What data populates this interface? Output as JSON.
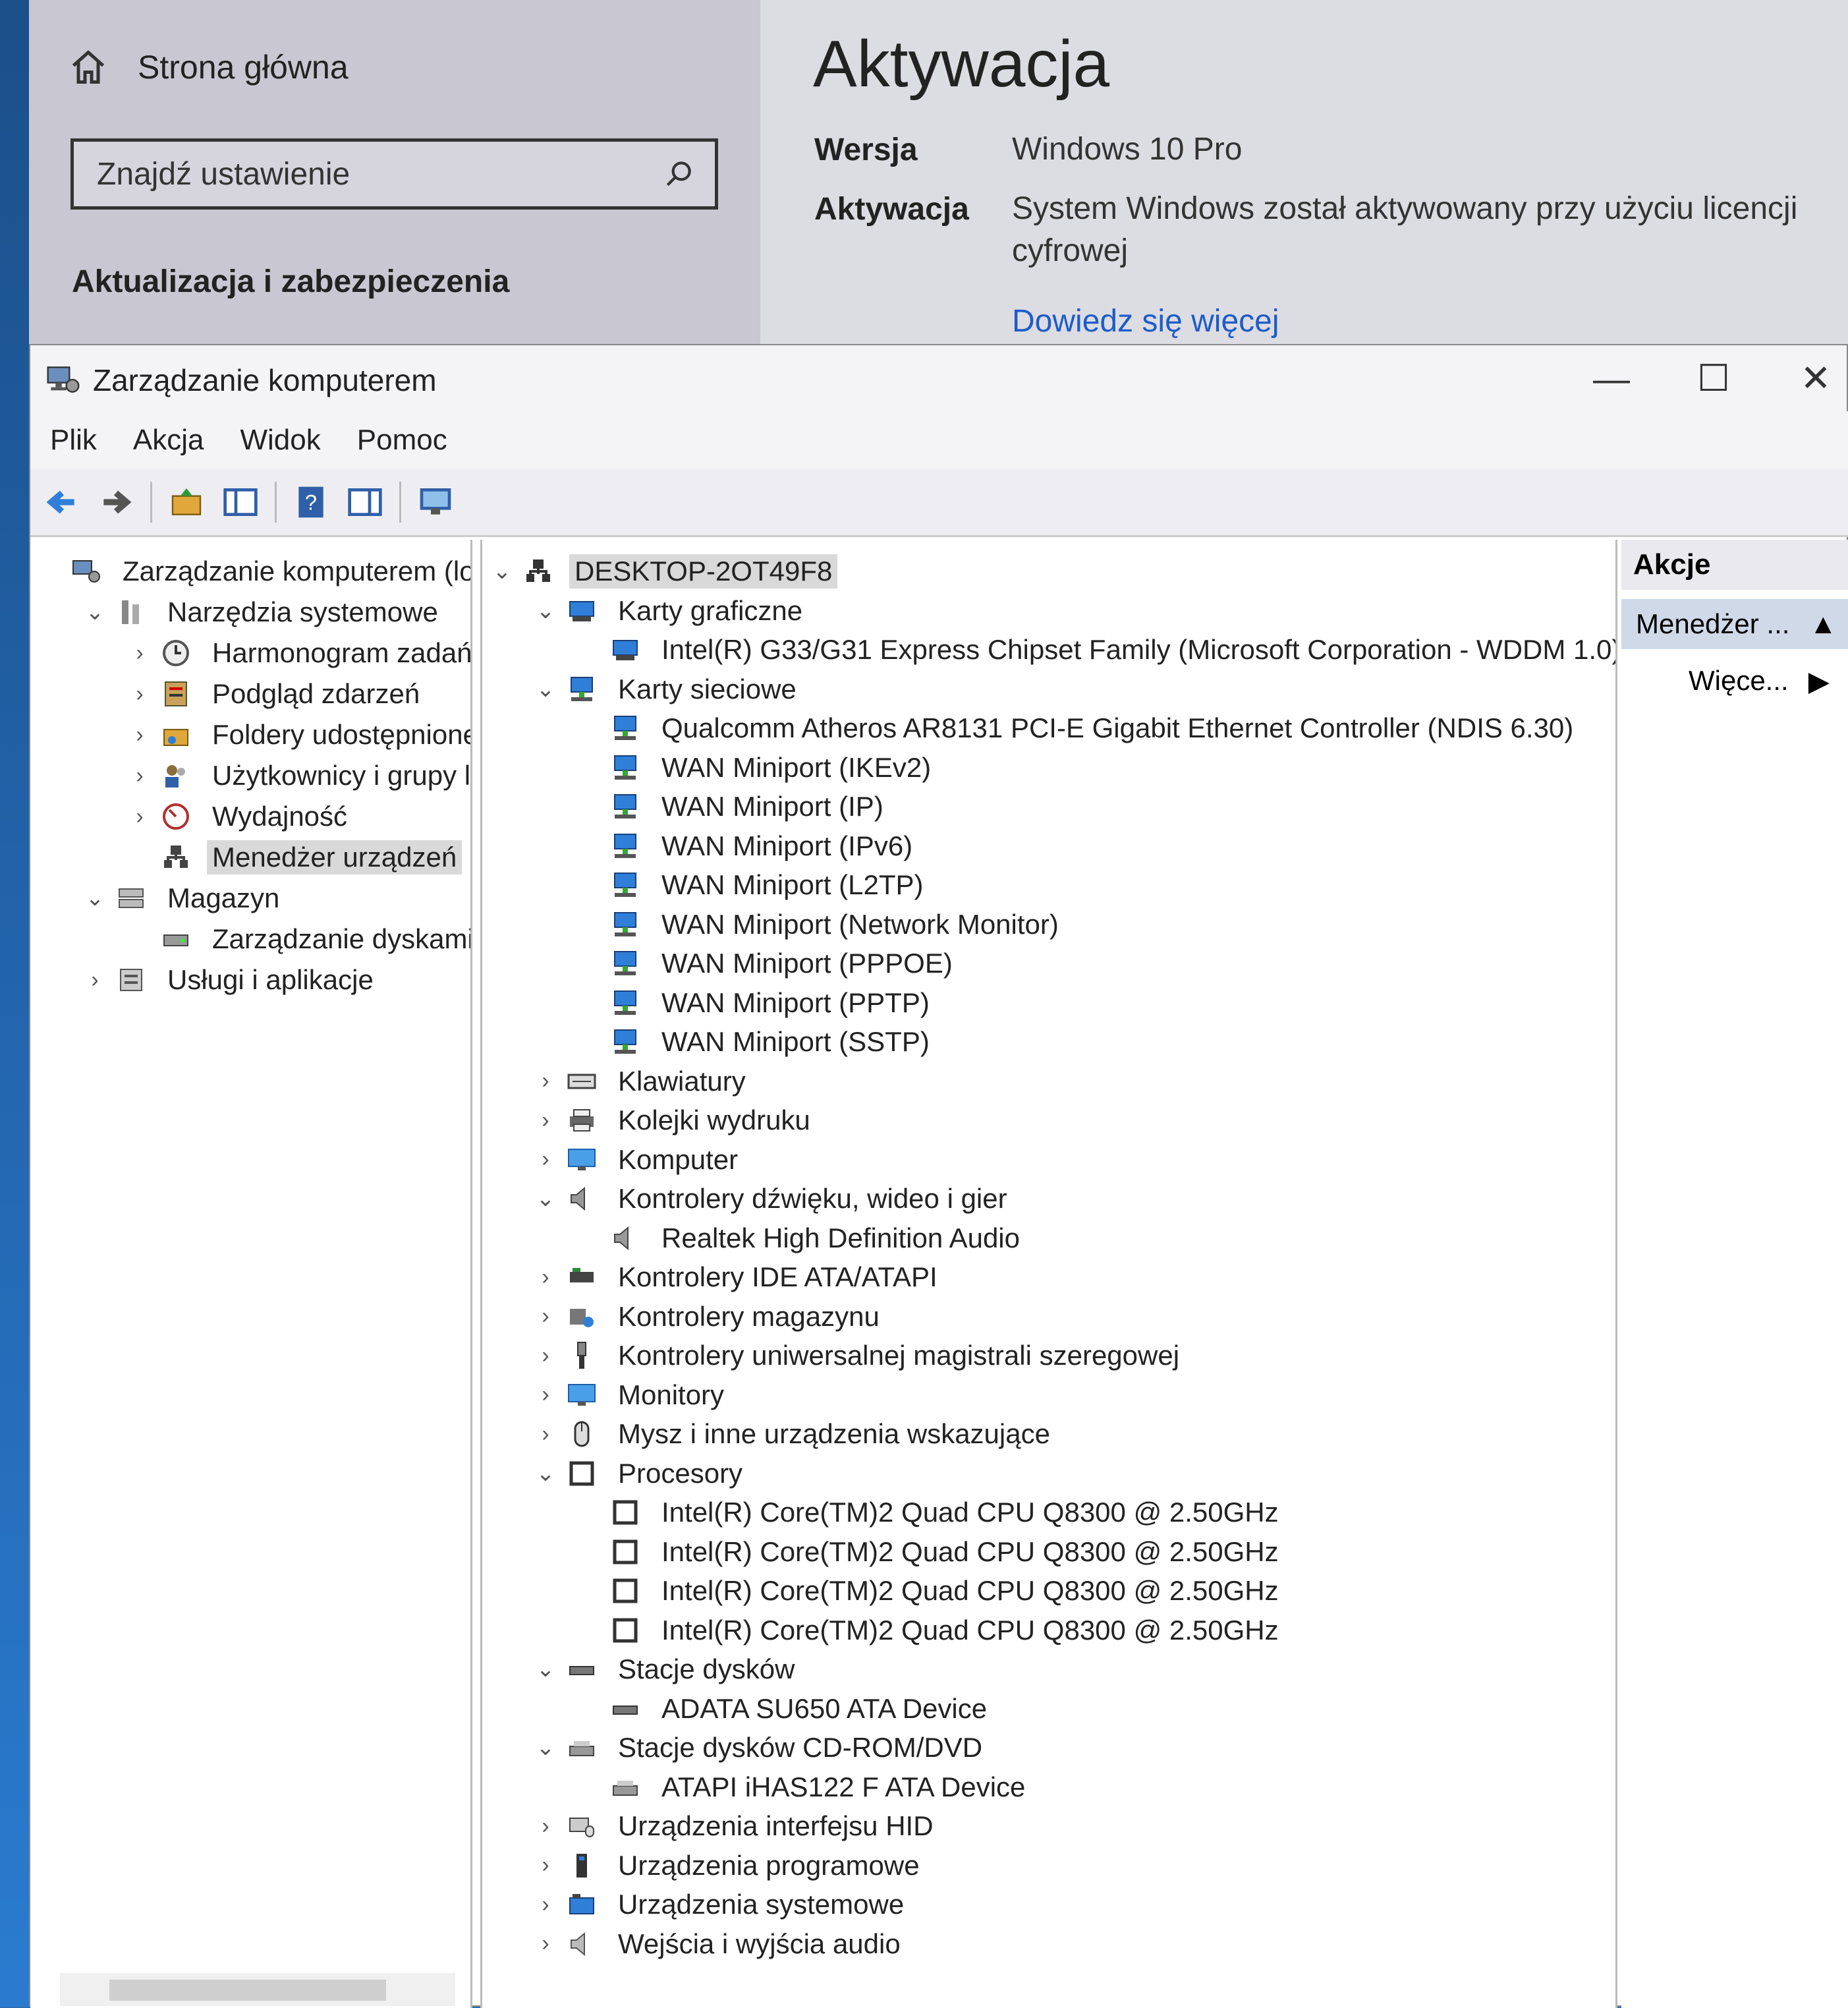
{
  "settings": {
    "home_label": "Strona główna",
    "search_placeholder": "Znajdź ustawienie",
    "section_title": "Aktualizacja i zabezpieczenia",
    "page_title": "Aktywacja",
    "edition_label": "Wersja",
    "edition_value": "Windows 10 Pro",
    "activation_label": "Aktywacja",
    "activation_value": "System Windows został aktywowany przy użyciu licencji cyfrowej",
    "learn_more_link": "Dowiedz się więcej"
  },
  "window": {
    "title": "Zarządzanie komputerem",
    "minimize": "—",
    "maximize": "☐",
    "close": "✕"
  },
  "menu": [
    "Plik",
    "Akcja",
    "Widok",
    "Pomoc"
  ],
  "toolbar_icons": [
    "back-icon",
    "forward-icon",
    "up-folder-icon",
    "show-hide-tree-icon",
    "help-icon",
    "properties-icon",
    "monitor-icon"
  ],
  "left_tree": [
    {
      "label": "Zarządzanie komputerem (lokalny)",
      "level": 0,
      "chev": "",
      "icon": "computer-management-icon"
    },
    {
      "label": "Narzędzia systemowe",
      "level": 1,
      "chev": "down",
      "icon": "system-tools-icon"
    },
    {
      "label": "Harmonogram zadań",
      "level": 2,
      "chev": "right",
      "icon": "clock-icon"
    },
    {
      "label": "Podgląd zdarzeń",
      "level": 2,
      "chev": "right",
      "icon": "event-viewer-icon"
    },
    {
      "label": "Foldery udostępnione",
      "level": 2,
      "chev": "right",
      "icon": "shared-folder-icon"
    },
    {
      "label": "Użytkownicy i grupy lokalne",
      "level": 2,
      "chev": "right",
      "icon": "users-icon"
    },
    {
      "label": "Wydajność",
      "level": 2,
      "chev": "right",
      "icon": "performance-icon"
    },
    {
      "label": "Menedżer urządzeń",
      "level": 2,
      "chev": "",
      "icon": "device-manager-icon",
      "selected": true
    },
    {
      "label": "Magazyn",
      "level": 1,
      "chev": "down",
      "icon": "storage-icon"
    },
    {
      "label": "Zarządzanie dyskami",
      "level": 2,
      "chev": "",
      "icon": "disk-management-icon"
    },
    {
      "label": "Usługi i aplikacje",
      "level": 1,
      "chev": "right",
      "icon": "services-icon"
    }
  ],
  "device_tree": [
    {
      "label": "DESKTOP-2OT49F8",
      "level": 0,
      "chev": "down",
      "icon": "computer-node-icon",
      "selected": true
    },
    {
      "label": "Karty graficzne",
      "level": 1,
      "chev": "down",
      "icon": "display-adapter-icon"
    },
    {
      "label": "Intel(R) G33/G31 Express Chipset Family (Microsoft Corporation - WDDM 1.0)",
      "level": 2,
      "chev": "",
      "icon": "display-adapter-icon"
    },
    {
      "label": "Karty sieciowe",
      "level": 1,
      "chev": "down",
      "icon": "network-adapter-icon"
    },
    {
      "label": "Qualcomm Atheros AR8131 PCI-E Gigabit Ethernet Controller (NDIS 6.30)",
      "level": 2,
      "chev": "",
      "icon": "network-adapter-icon"
    },
    {
      "label": "WAN Miniport (IKEv2)",
      "level": 2,
      "chev": "",
      "icon": "network-adapter-icon"
    },
    {
      "label": "WAN Miniport (IP)",
      "level": 2,
      "chev": "",
      "icon": "network-adapter-icon"
    },
    {
      "label": "WAN Miniport (IPv6)",
      "level": 2,
      "chev": "",
      "icon": "network-adapter-icon"
    },
    {
      "label": "WAN Miniport (L2TP)",
      "level": 2,
      "chev": "",
      "icon": "network-adapter-icon"
    },
    {
      "label": "WAN Miniport (Network Monitor)",
      "level": 2,
      "chev": "",
      "icon": "network-adapter-icon"
    },
    {
      "label": "WAN Miniport (PPPOE)",
      "level": 2,
      "chev": "",
      "icon": "network-adapter-icon"
    },
    {
      "label": "WAN Miniport (PPTP)",
      "level": 2,
      "chev": "",
      "icon": "network-adapter-icon"
    },
    {
      "label": "WAN Miniport (SSTP)",
      "level": 2,
      "chev": "",
      "icon": "network-adapter-icon"
    },
    {
      "label": "Klawiatury",
      "level": 1,
      "chev": "right",
      "icon": "keyboard-icon"
    },
    {
      "label": "Kolejki wydruku",
      "level": 1,
      "chev": "right",
      "icon": "printer-icon"
    },
    {
      "label": "Komputer",
      "level": 1,
      "chev": "right",
      "icon": "monitor-icon"
    },
    {
      "label": "Kontrolery dźwięku, wideo i gier",
      "level": 1,
      "chev": "down",
      "icon": "speaker-icon"
    },
    {
      "label": "Realtek High Definition Audio",
      "level": 2,
      "chev": "",
      "icon": "speaker-icon"
    },
    {
      "label": "Kontrolery IDE ATA/ATAPI",
      "level": 1,
      "chev": "right",
      "icon": "ide-controller-icon"
    },
    {
      "label": "Kontrolery magazynu",
      "level": 1,
      "chev": "right",
      "icon": "storage-controller-icon"
    },
    {
      "label": "Kontrolery uniwersalnej magistrali szeregowej",
      "level": 1,
      "chev": "right",
      "icon": "usb-icon"
    },
    {
      "label": "Monitory",
      "level": 1,
      "chev": "right",
      "icon": "monitor-icon"
    },
    {
      "label": "Mysz i inne urządzenia wskazujące",
      "level": 1,
      "chev": "right",
      "icon": "mouse-icon"
    },
    {
      "label": "Procesory",
      "level": 1,
      "chev": "down",
      "icon": "processor-icon"
    },
    {
      "label": "Intel(R) Core(TM)2 Quad CPU    Q8300  @ 2.50GHz",
      "level": 2,
      "chev": "",
      "icon": "processor-icon"
    },
    {
      "label": "Intel(R) Core(TM)2 Quad CPU    Q8300  @ 2.50GHz",
      "level": 2,
      "chev": "",
      "icon": "processor-icon"
    },
    {
      "label": "Intel(R) Core(TM)2 Quad CPU    Q8300  @ 2.50GHz",
      "level": 2,
      "chev": "",
      "icon": "processor-icon"
    },
    {
      "label": "Intel(R) Core(TM)2 Quad CPU    Q8300  @ 2.50GHz",
      "level": 2,
      "chev": "",
      "icon": "processor-icon"
    },
    {
      "label": "Stacje dysków",
      "level": 1,
      "chev": "down",
      "icon": "disk-drive-icon"
    },
    {
      "label": "ADATA SU650 ATA Device",
      "level": 2,
      "chev": "",
      "icon": "disk-drive-icon"
    },
    {
      "label": "Stacje dysków CD-ROM/DVD",
      "level": 1,
      "chev": "down",
      "icon": "dvd-drive-icon"
    },
    {
      "label": "ATAPI iHAS122   F ATA Device",
      "level": 2,
      "chev": "",
      "icon": "dvd-drive-icon"
    },
    {
      "label": "Urządzenia interfejsu HID",
      "level": 1,
      "chev": "right",
      "icon": "hid-icon"
    },
    {
      "label": "Urządzenia programowe",
      "level": 1,
      "chev": "right",
      "icon": "software-device-icon"
    },
    {
      "label": "Urządzenia systemowe",
      "level": 1,
      "chev": "right",
      "icon": "system-devices-icon"
    },
    {
      "label": "Wejścia i wyjścia audio",
      "level": 1,
      "chev": "right",
      "icon": "audio-io-icon"
    }
  ],
  "actions": {
    "header": "Akcje",
    "item1": "Menedżer ...",
    "item2": "Więce..."
  },
  "colors": {
    "selection": "#d9d9d9",
    "link": "#1e5cc7",
    "network": "#2f7fd8",
    "accent_blue": "#1e5cc7"
  }
}
